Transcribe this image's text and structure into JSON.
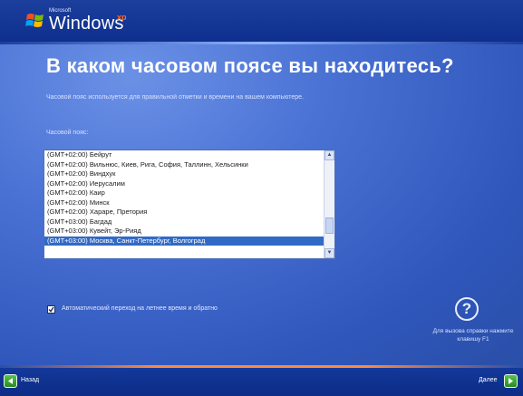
{
  "header": {
    "brand_small": "Microsoft",
    "brand": "Windows",
    "brand_suffix": "xp"
  },
  "page": {
    "title": "В каком часовом поясе вы находитесь?",
    "description": "Часовой пояс используется для правильной отметки и времени на вашем компьютере.",
    "timezone_label": "Часовой пояс:"
  },
  "timezones": [
    {
      "label": "(GMT+02:00) Бейрут"
    },
    {
      "label": "(GMT+02:00) Вильнюс, Киев, Рига, София, Таллинн, Хельсинки"
    },
    {
      "label": "(GMT+02:00) Виндхук"
    },
    {
      "label": "(GMT+02:00) Иерусалим"
    },
    {
      "label": "(GMT+02:00) Каир"
    },
    {
      "label": "(GMT+02:00) Минск"
    },
    {
      "label": "(GMT+02:00) Хараре, Претория"
    },
    {
      "label": "(GMT+03:00) Багдад"
    },
    {
      "label": "(GMT+03:00) Кувейт, Эр-Рияд"
    },
    {
      "label": "(GMT+03:00) Москва, Санкт-Петербург, Волгоград"
    }
  ],
  "selected_index": 9,
  "dst": {
    "checked": true,
    "label": "Автоматический переход на летнее время и обратно"
  },
  "help": {
    "text": "Для вызова справки нажмите клавишу F1"
  },
  "footer": {
    "back_label": "Назад",
    "next_label": "Далее"
  },
  "colors": {
    "selection": "#316ac5",
    "accent_line": "#ff8a3a",
    "nav_button": "#3fa637"
  }
}
